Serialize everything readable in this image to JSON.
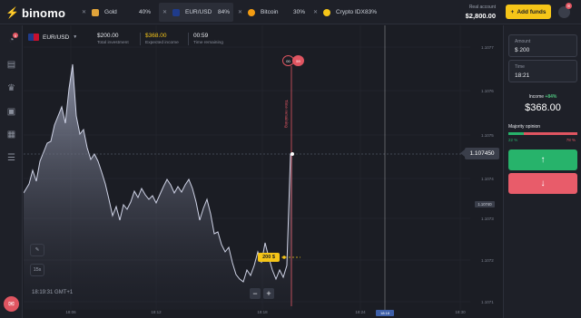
{
  "header": {
    "logo_text": "binomo",
    "tabs": [
      {
        "name": "Gold",
        "pct": "40%",
        "icon_color": "#e0a33a",
        "active": false
      },
      {
        "name": "EUR/USD",
        "pct": "84%",
        "icon_color": "#1f3b8a",
        "active": true
      },
      {
        "name": "Bitcoin",
        "pct": "30%",
        "icon_color": "#f39c12",
        "active": false
      },
      {
        "name": "Crypto IDX",
        "pct": "83%",
        "icon_color": "#f5c518",
        "active": false
      }
    ],
    "account_label": "Real account",
    "balance": "$2,800.00",
    "add_funds": "Add funds",
    "notification_count": "8"
  },
  "sidebar": {
    "badge": "5",
    "icons": [
      "speedometer-icon",
      "chart-icon",
      "trophy-icon",
      "gift-icon",
      "calendar-icon",
      "settings-sliders-icon"
    ],
    "chat_icon": "chat-icon"
  },
  "chart": {
    "pair": "EUR/USD",
    "investment_value": "$200.00",
    "investment_label": "Total investment",
    "income_value": "$368.00",
    "income_label": "Expected income",
    "time_value": "00:59",
    "time_label": "Time remaining",
    "current_price": "1.107450",
    "y_ticks": [
      "1.1077",
      "1.1076",
      "1.1075",
      "1.1074",
      "1.1073",
      "1.1072",
      "1.1071"
    ],
    "x_ticks": [
      "18:06",
      "18:12",
      "18:18",
      "18:24",
      "18:30"
    ],
    "now_label": "18:18",
    "bet_label": "200 $",
    "expiry_left": "00",
    "expiry_right": "59",
    "expiry_text": "Time remaining",
    "time_readout": "18:19:31 GMT+1",
    "zoom_minus": "−",
    "zoom_plus": "+",
    "tool_a": "✎",
    "tool_b": "15s",
    "line_color": "#cfd3e6",
    "up_color": "#27b36b",
    "down_color": "#e05561",
    "small_tag": "1.10740"
  },
  "panel": {
    "amount_label": "Amount",
    "amount_value": "$ 200",
    "time_label": "Time",
    "time_value": "18:21",
    "income_label": "Income",
    "income_pct": "+84%",
    "income_value": "$368.00",
    "majority_label": "Majority opinion",
    "majority_up": "22 %",
    "majority_down": "78 %",
    "majority_up_fraction": 0.22,
    "up_icon": "↑",
    "down_icon": "↓"
  }
}
